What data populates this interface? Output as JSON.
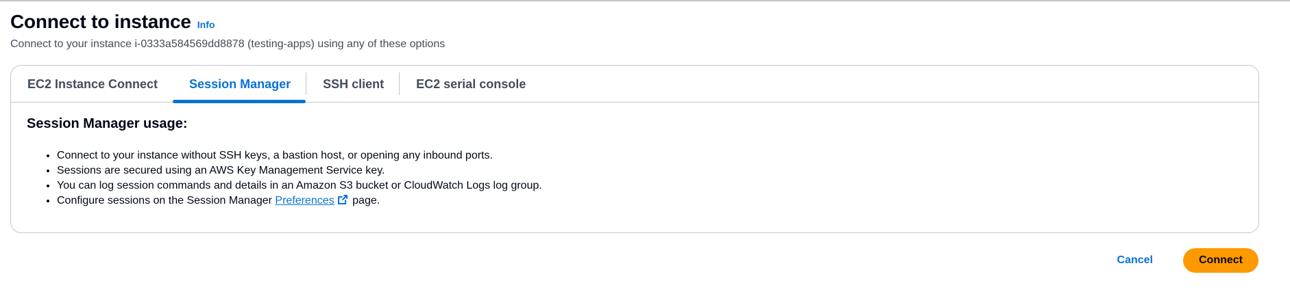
{
  "header": {
    "title": "Connect to instance",
    "info_label": "Info",
    "subtitle": "Connect to your instance i-0333a584569dd8878 (testing-apps) using any of these options"
  },
  "tabs": [
    {
      "label": "EC2 Instance Connect",
      "active": false
    },
    {
      "label": "Session Manager",
      "active": true
    },
    {
      "label": "SSH client",
      "active": false
    },
    {
      "label": "EC2 serial console",
      "active": false
    }
  ],
  "session_manager": {
    "heading": "Session Manager usage:",
    "bullets": [
      "Connect to your instance without SSH keys, a bastion host, or opening any inbound ports.",
      "Sessions are secured using an AWS Key Management Service key.",
      "You can log session commands and details in an Amazon S3 bucket or CloudWatch Logs log group."
    ],
    "preferences_prefix": "Configure sessions on the Session Manager",
    "preferences_link": "Preferences",
    "preferences_suffix": "page.",
    "external_icon": "external-link-icon"
  },
  "actions": {
    "cancel_label": "Cancel",
    "connect_label": "Connect"
  },
  "colors": {
    "accent": "#0972d3",
    "primary_button": "#ff9900",
    "border": "#c6c6cd",
    "text": "#000716",
    "secondary_text": "#414d5c"
  }
}
